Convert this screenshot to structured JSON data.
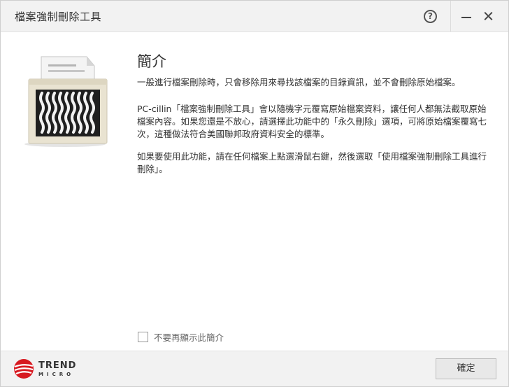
{
  "window": {
    "title": "檔案強制刪除工具",
    "help_label": "?"
  },
  "content": {
    "heading": "簡介",
    "paragraph_1": "一般進行檔案刪除時，只會移除用來尋找該檔案的目錄資訊，並不會刪除原始檔案。",
    "paragraph_2": "PC-cillin「檔案強制刪除工具」會以隨機字元覆寫原始檔案資料，讓任何人都無法截取原始檔案內容。如果您還是不放心，請選擇此功能中的「永久刪除」選項，可將原始檔案覆寫七次，這種做法符合美國聯邦政府資料安全的標準。",
    "paragraph_3": "如果要使用此功能，請在任何檔案上點選滑鼠右鍵，然後選取「使用檔案強制刪除工具進行刪除」。"
  },
  "options": {
    "dont_show_label": "不要再顯示此簡介",
    "dont_show_checked": false
  },
  "footer": {
    "brand_main": "TREND",
    "brand_sub": "MICRO",
    "ok_label": "確定"
  },
  "colors": {
    "brand_red": "#d71920",
    "titlebar_bg": "#f2f2f2",
    "footer_bg": "#f2f2f2",
    "text": "#333333"
  }
}
